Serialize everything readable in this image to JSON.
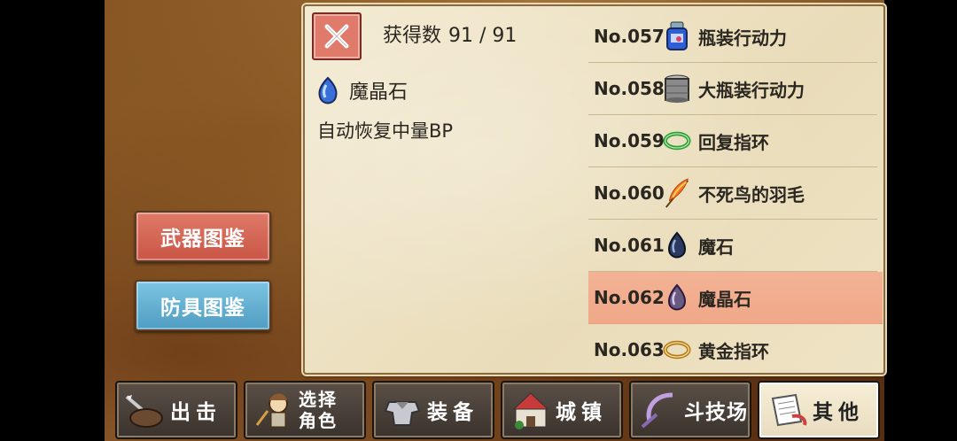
{
  "side_buttons": {
    "weapon": "武器图鉴",
    "armor": "防具图鉴"
  },
  "panel": {
    "close_label": "×",
    "count_label": "获得数",
    "count_value": "91 / 91",
    "selected_item": {
      "name": "魔晶石",
      "description": "自动恢复中量BP",
      "icon": "magic-crystal-icon"
    }
  },
  "list": [
    {
      "no": "No.057",
      "name": "瓶装行动力",
      "icon": "bottle-icon"
    },
    {
      "no": "No.058",
      "name": "大瓶装行动力",
      "icon": "big-bottle-icon"
    },
    {
      "no": "No.059",
      "name": "回复指环",
      "icon": "green-ring-icon"
    },
    {
      "no": "No.060",
      "name": "不死鸟的羽毛",
      "icon": "phoenix-feather-icon"
    },
    {
      "no": "No.061",
      "name": "魔石",
      "icon": "magic-stone-icon"
    },
    {
      "no": "No.062",
      "name": "魔晶石",
      "icon": "magic-crystal-icon",
      "selected": true
    },
    {
      "no": "No.063",
      "name": "黄金指环",
      "icon": "gold-ring-icon"
    }
  ],
  "tabs": [
    {
      "label": "出击",
      "icon": "sortie-icon"
    },
    {
      "label": "选择角色",
      "line1": "选择",
      "line2": "角色",
      "icon": "character-icon"
    },
    {
      "label": "装备",
      "icon": "equipment-icon"
    },
    {
      "label": "城镇",
      "icon": "town-icon"
    },
    {
      "label": "斗技场",
      "icon": "arena-icon"
    },
    {
      "label": "其他",
      "icon": "scroll-icon",
      "active": true
    }
  ],
  "colors": {
    "weapon_button": "#d96a58",
    "armor_button": "#66b3d6",
    "selected_row": "#f2ad8e",
    "close_button": "#e07a6a"
  }
}
